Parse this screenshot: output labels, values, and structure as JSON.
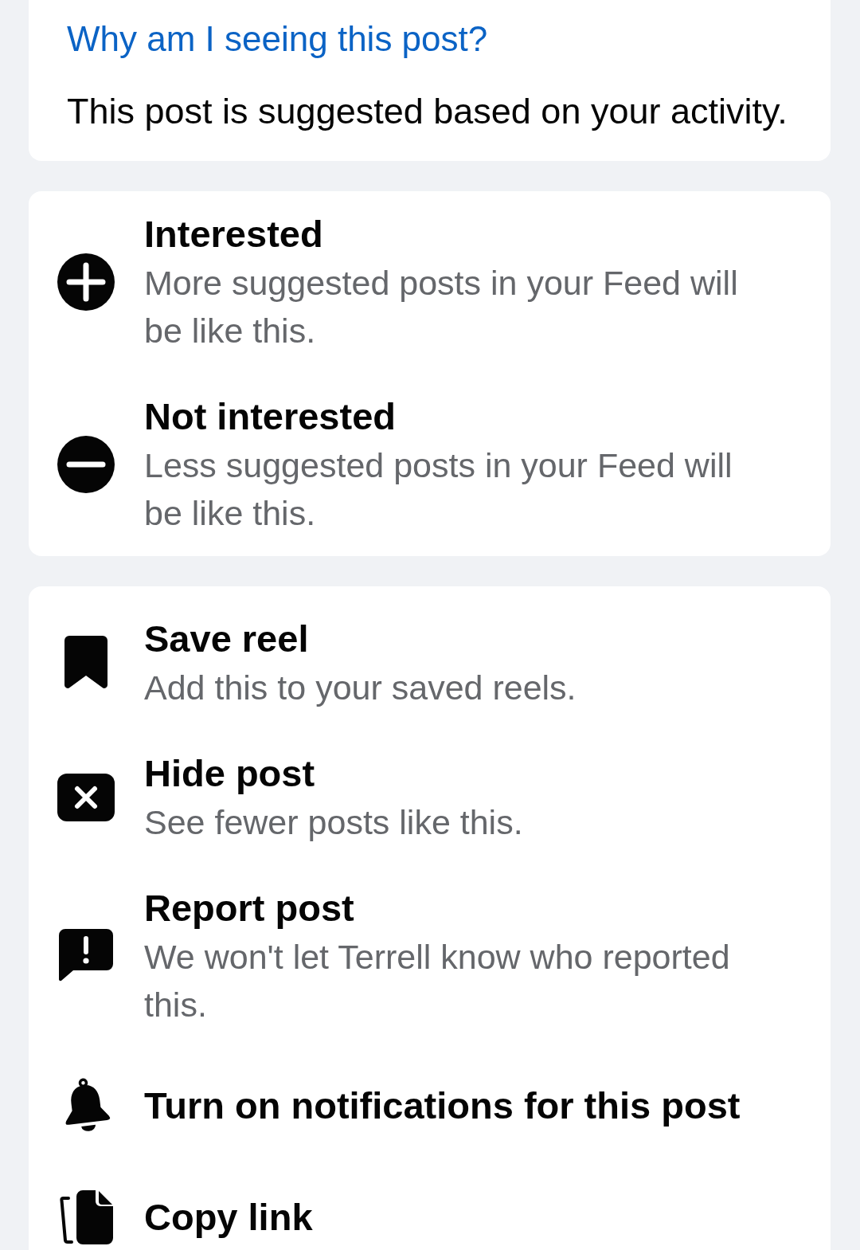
{
  "explanation": {
    "link": "Why am I seeing this post?",
    "text": "This post is suggested based on your activity."
  },
  "feedback_options": [
    {
      "kind": "add",
      "title": "Interested",
      "description": "More suggested posts in your Feed will be like this."
    },
    {
      "kind": "remove",
      "title": "Not interested",
      "description": "Less suggested posts in your Feed will be like this."
    }
  ],
  "actions": [
    {
      "kind": "save",
      "title": "Save reel",
      "description": "Add this to your saved reels."
    },
    {
      "kind": "hide",
      "title": "Hide post",
      "description": "See fewer posts like this."
    },
    {
      "kind": "report",
      "title": "Report post",
      "description": "We won't let Terrell know who reported this."
    },
    {
      "kind": "notify",
      "title": "Turn on notifications for this post"
    },
    {
      "kind": "copy",
      "title": "Copy link"
    }
  ]
}
